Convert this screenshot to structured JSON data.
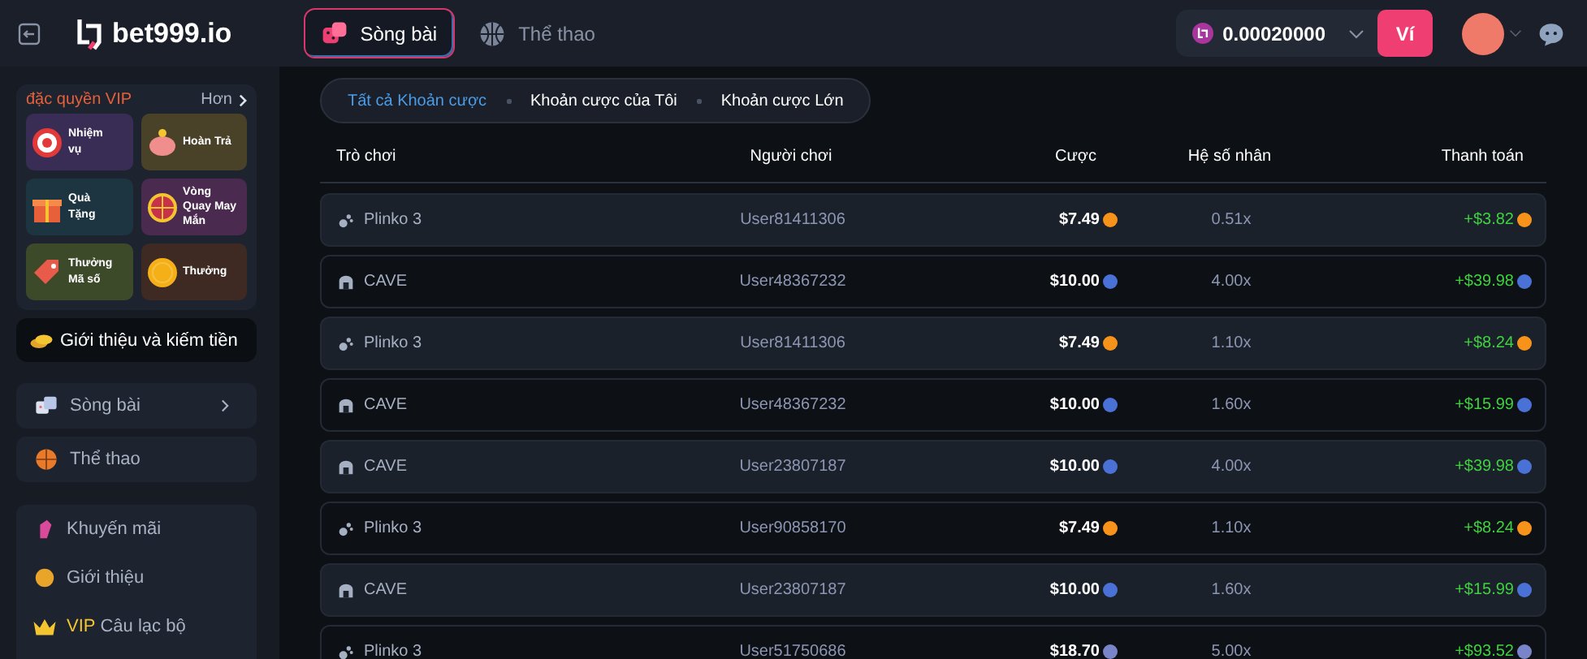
{
  "header": {
    "logo": "bet999.io",
    "tabs": [
      {
        "label": "Sòng bài",
        "kind": "casino",
        "selected": true
      },
      {
        "label": "Thể thao",
        "kind": "sports",
        "selected": false
      }
    ],
    "balance": "0.00020000",
    "wallet_button": "Ví"
  },
  "sidebar": {
    "vip": {
      "title": "đặc quyền VIP",
      "more": "Hơn",
      "tiles": [
        {
          "label": "Nhiệm vụ",
          "kind": "target"
        },
        {
          "label": "Hoàn Trả",
          "kind": "piggy"
        },
        {
          "label": "Quà Tặng",
          "kind": "gift"
        },
        {
          "label": "Vòng Quay May Mắn",
          "kind": "wheel"
        },
        {
          "label": "Thưởng Mã số",
          "kind": "tag"
        },
        {
          "label": "Thưởng",
          "kind": "coin"
        }
      ]
    },
    "referral": "Giới thiệu và kiếm tiền",
    "nav": [
      {
        "label": "Sòng bài",
        "kind": "casino",
        "expandable": true
      },
      {
        "label": "Thể thao",
        "kind": "sports",
        "expandable": false
      }
    ],
    "links": [
      {
        "label": "Khuyến mãi",
        "kind": "promo"
      },
      {
        "label": "Giới thiệu",
        "kind": "coin"
      },
      {
        "badge": "VIP",
        "label": "Câu lạc bộ",
        "kind": "crown"
      }
    ]
  },
  "bets": {
    "filters": [
      {
        "label": "Tất cả Khoản cược",
        "selected": true
      },
      {
        "label": "Khoản cược của Tôi",
        "selected": false
      },
      {
        "label": "Khoản cược Lớn",
        "selected": false
      }
    ],
    "columns": [
      "Trò chơi",
      "Người chơi",
      "Cược",
      "Hệ số nhân",
      "Thanh toán"
    ],
    "rows": [
      {
        "game": "Plinko 3",
        "kind": "plinko",
        "player": "User81411306",
        "bet": {
          "text": "$7.49",
          "kind": "btc"
        },
        "multiplier": "0.51x",
        "payout": {
          "text": "+$3.82",
          "kind": "btc"
        }
      },
      {
        "game": "CAVE",
        "kind": "cave",
        "player": "User48367232",
        "bet": {
          "text": "$10.00",
          "kind": "xrp"
        },
        "multiplier": "4.00x",
        "payout": {
          "text": "+$39.98",
          "kind": "xrp"
        }
      },
      {
        "game": "Plinko 3",
        "kind": "plinko",
        "player": "User81411306",
        "bet": {
          "text": "$7.49",
          "kind": "btc"
        },
        "multiplier": "1.10x",
        "payout": {
          "text": "+$8.24",
          "kind": "btc"
        }
      },
      {
        "game": "CAVE",
        "kind": "cave",
        "player": "User48367232",
        "bet": {
          "text": "$10.00",
          "kind": "xrp"
        },
        "multiplier": "1.60x",
        "payout": {
          "text": "+$15.99",
          "kind": "xrp"
        }
      },
      {
        "game": "CAVE",
        "kind": "cave",
        "player": "User23807187",
        "bet": {
          "text": "$10.00",
          "kind": "xrp"
        },
        "multiplier": "4.00x",
        "payout": {
          "text": "+$39.98",
          "kind": "xrp"
        }
      },
      {
        "game": "Plinko 3",
        "kind": "plinko",
        "player": "User90858170",
        "bet": {
          "text": "$7.49",
          "kind": "btc"
        },
        "multiplier": "1.10x",
        "payout": {
          "text": "+$8.24",
          "kind": "btc"
        }
      },
      {
        "game": "CAVE",
        "kind": "cave",
        "player": "User23807187",
        "bet": {
          "text": "$10.00",
          "kind": "xrp"
        },
        "multiplier": "1.60x",
        "payout": {
          "text": "+$15.99",
          "kind": "xrp"
        }
      },
      {
        "game": "Plinko 3",
        "kind": "plinko",
        "player": "User51750686",
        "bet": {
          "text": "$18.70",
          "kind": "eth"
        },
        "multiplier": "5.00x",
        "payout": {
          "text": "+$93.52",
          "kind": "eth"
        }
      }
    ]
  }
}
